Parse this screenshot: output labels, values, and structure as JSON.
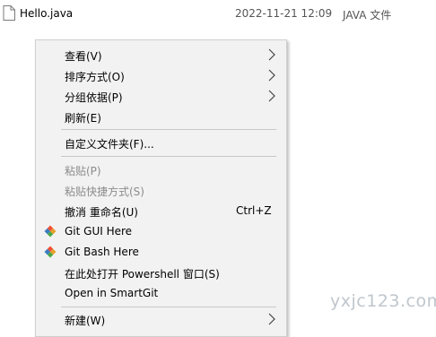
{
  "file": {
    "name": "Hello.java",
    "modified": "2022-11-21 12:09",
    "type": "JAVA 文件",
    "icon": "document-icon"
  },
  "menu": {
    "items": [
      {
        "label": "查看(V)",
        "submenu": true,
        "enabled": true
      },
      {
        "label": "排序方式(O)",
        "submenu": true,
        "enabled": true
      },
      {
        "label": "分组依据(P)",
        "submenu": true,
        "enabled": true
      },
      {
        "label": "刷新(E)",
        "enabled": true
      },
      {
        "label": "自定义文件夹(F)...",
        "enabled": true
      },
      {
        "label": "粘贴(P)",
        "enabled": false
      },
      {
        "label": "粘贴快捷方式(S)",
        "enabled": false
      },
      {
        "label": "撤消 重命名(U)",
        "shortcut": "Ctrl+Z",
        "enabled": true
      },
      {
        "label": "Git GUI Here",
        "icon": "git-icon",
        "enabled": true
      },
      {
        "label": "Git Bash Here",
        "icon": "git-icon",
        "enabled": true
      },
      {
        "label": "在此处打开 Powershell 窗口(S)",
        "enabled": true
      },
      {
        "label": "Open in SmartGit",
        "enabled": true
      },
      {
        "label": "新建(W)",
        "submenu": true,
        "enabled": true
      }
    ]
  },
  "watermark": "yxjc123.com",
  "colors": {
    "menu_background": "#f2f2f2",
    "disabled_text": "#8c8c8c",
    "git_orange": "#f05033",
    "git_green": "#4aa64a",
    "git_blue": "#3b7bbf"
  }
}
